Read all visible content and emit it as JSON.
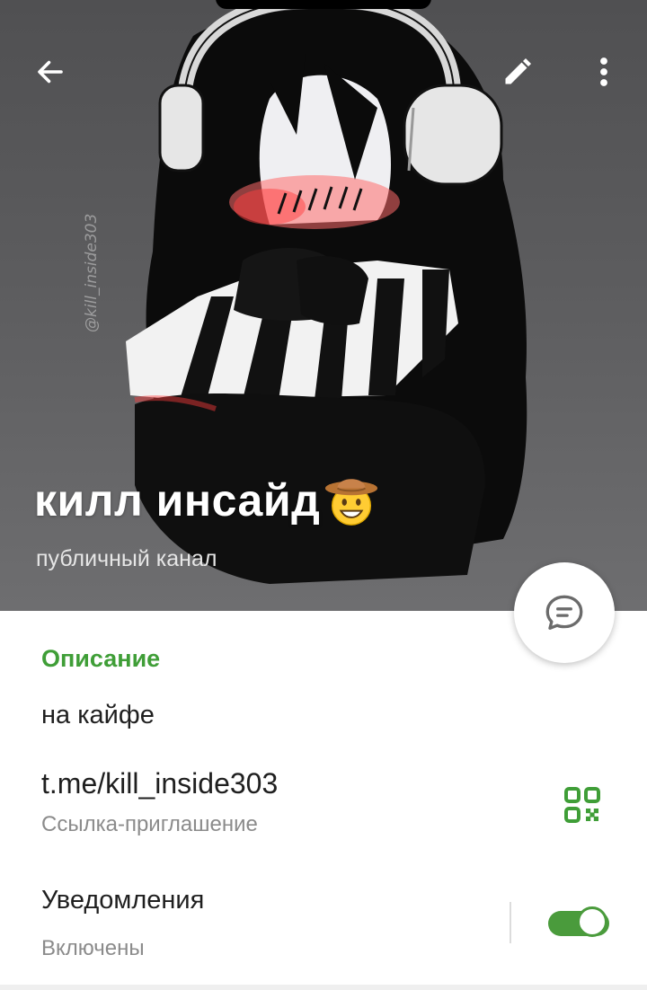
{
  "header": {
    "watermark": "@kill_inside303",
    "title": "килл инсайд",
    "subtitle": "публичный канал",
    "icons": [
      "back-arrow-icon",
      "edit-pencil-icon",
      "more-vertical-icon",
      "message-icon"
    ]
  },
  "info": {
    "section_title": "Описание",
    "description": "на кайфе",
    "link": "t.me/kill_inside303",
    "link_caption": "Ссылка-приглашение",
    "qr_icon": "qr-code-icon"
  },
  "notifications": {
    "title": "Уведомления",
    "status": "Включены",
    "enabled": true
  },
  "colors": {
    "accent": "#3f9e37",
    "toggle": "#4a9b3c",
    "secondary_text": "#8b8b8b",
    "cover_bg": "#5a5a5c"
  }
}
